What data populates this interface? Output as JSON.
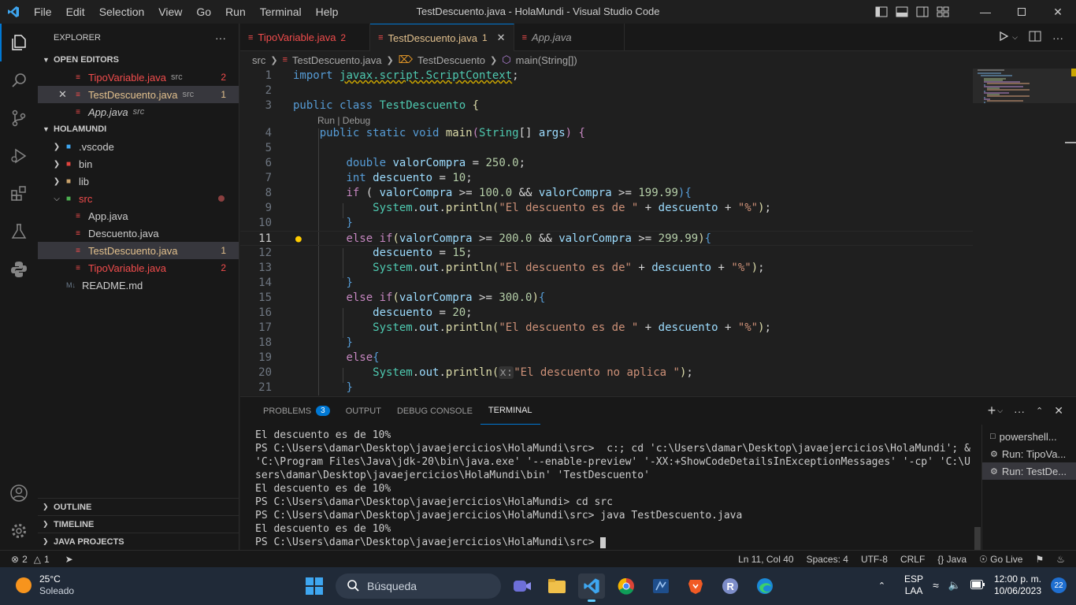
{
  "titlebar": {
    "menu": [
      "File",
      "Edit",
      "Selection",
      "View",
      "Go",
      "Run",
      "Terminal",
      "Help"
    ],
    "title": "TestDescuento.java - HolaMundi - Visual Studio Code"
  },
  "sidebar": {
    "title": "EXPLORER",
    "more": "···",
    "open_editors": {
      "label": "OPEN EDITORS",
      "items": [
        {
          "name": "TipoVariable.java",
          "desc": "src",
          "badge": "2"
        },
        {
          "name": "TestDescuento.java",
          "desc": "src",
          "badge": "1"
        },
        {
          "name": "App.java",
          "desc": "src",
          "badge": ""
        }
      ]
    },
    "project": {
      "label": "HOLAMUNDI",
      "items": [
        {
          "name": ".vscode"
        },
        {
          "name": "bin"
        },
        {
          "name": "lib"
        },
        {
          "name": "src"
        },
        {
          "name": "App.java"
        },
        {
          "name": "Descuento.java"
        },
        {
          "name": "TestDescuento.java",
          "badge": "1"
        },
        {
          "name": "TipoVariable.java",
          "badge": "2"
        },
        {
          "name": "README.md"
        }
      ]
    },
    "bottom": [
      "OUTLINE",
      "TIMELINE",
      "JAVA PROJECTS"
    ]
  },
  "tabs": [
    {
      "name": "TipoVariable.java",
      "badge": "2"
    },
    {
      "name": "TestDescuento.java",
      "badge": "1"
    },
    {
      "name": "App.java",
      "badge": ""
    }
  ],
  "breadcrumb": [
    "src",
    "TestDescuento.java",
    "TestDescuento",
    "main(String[])"
  ],
  "editor": {
    "lens": "Run | Debug",
    "line_numbers": [
      "1",
      "2",
      "3",
      "4",
      "5",
      "6",
      "7",
      "8",
      "9",
      "10",
      "11",
      "12",
      "13",
      "14",
      "15",
      "16",
      "17",
      "18",
      "19",
      "20",
      "21"
    ],
    "code": {
      "l1_kw": "import",
      "l1_pkg": "javax.script.ScriptContext",
      "l3_kw": "public class",
      "l3_name": "TestDescuento",
      "l4_kw": "public static void",
      "l4_fn": "main",
      "l4_type": "String",
      "l4_arg": "args",
      "l6_type": "double",
      "l6_var": "valorCompra",
      "l6_num": "250.0",
      "l7_type": "int",
      "l7_var": "descuento",
      "l7_num": "10",
      "l8_v1": "valorCompra",
      "l8_n1": "100.0",
      "l8_v2": "valorCompra",
      "l8_n2": "199.99",
      "s9": "\"El descuento es de \"",
      "l11_v1": "valorCompra",
      "l11_n1": "200.0",
      "l11_v2": "valorCompra",
      "l11_n2": "299.99",
      "l12_num": "15",
      "s13": "\"El descuento es de\"",
      "l15_v": "valorCompra",
      "l15_n": "300.0",
      "l16_num": "20",
      "s17": "\"El descuento es de \"",
      "s20": "\"El descuento no aplica \"",
      "hint": "x:",
      "pct": "\"%\""
    }
  },
  "panel": {
    "tabs": [
      "PROBLEMS",
      "OUTPUT",
      "DEBUG CONSOLE",
      "TERMINAL"
    ],
    "problems_count": "3",
    "terminal_lines": [
      "El descuento es de 10%",
      "PS C:\\Users\\damar\\Desktop\\javaejercicios\\HolaMundi\\src>  c:; cd 'c:\\Users\\damar\\Desktop\\javaejercicios\\HolaMundi'; & 'C:\\Program Files\\Java\\jdk-20\\bin\\java.exe' '--enable-preview' '-XX:+ShowCodeDetailsInExceptionMessages' '-cp' 'C:\\Users\\damar\\Desktop\\javaejercicios\\HolaMundi\\bin' 'TestDescuento'",
      "El descuento es de 10%",
      "PS C:\\Users\\damar\\Desktop\\javaejercicios\\HolaMundi> cd src",
      "PS C:\\Users\\damar\\Desktop\\javaejercicios\\HolaMundi\\src> java TestDescuento.java",
      "El descuento es de 10%",
      "PS C:\\Users\\damar\\Desktop\\javaejercicios\\HolaMundi\\src> "
    ],
    "terminals": [
      "powershell...",
      "Run: TipoVa...",
      "Run: TestDe..."
    ]
  },
  "statusbar": {
    "errors": "2",
    "warnings": "1",
    "position": "Ln 11, Col 40",
    "spaces": "Spaces: 4",
    "encoding": "UTF-8",
    "eol": "CRLF",
    "language": "Java",
    "golive": "Go Live"
  },
  "taskbar": {
    "temp": "25°C",
    "weather": "Soleado",
    "search": "Búsqueda",
    "lang1": "ESP",
    "lang2": "LAA",
    "time": "12:00 p. m.",
    "date": "10/06/2023",
    "notifications": "22"
  },
  "colors": {
    "accent": "#0078d4",
    "error": "#f14c4c",
    "modified": "#e2c08d",
    "warning": "#cca700"
  }
}
